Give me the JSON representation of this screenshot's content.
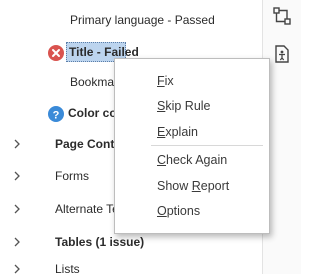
{
  "tree": {
    "primary_language": "Primary language - Passed",
    "title_item": "Title - Failed",
    "bookmarks_partial": "Bookmar",
    "color_contrast_partial": "Color cor",
    "page_content_partial": "Page Conte",
    "forms": "Forms",
    "alternate_text_partial": "Alternate Te",
    "tables": "Tables (1 issue)",
    "lists": "Lists"
  },
  "context_menu": {
    "fix": {
      "key": "F",
      "rest": "ix"
    },
    "skip_rule": {
      "key": "S",
      "rest": "kip Rule"
    },
    "explain": {
      "key": "E",
      "rest": "xplain"
    },
    "check_again": {
      "key": "C",
      "rest": "heck Again"
    },
    "show_report": {
      "pre": "Show ",
      "key": "R",
      "rest": "eport"
    },
    "options": {
      "key": "O",
      "rest": "ptions"
    }
  },
  "colors": {
    "failed": "#d9534f",
    "info": "#3a8ad8",
    "selection": "#bcd4ee"
  },
  "icons": {
    "failed": "failed-x-icon",
    "info": "question-icon",
    "expand": "chevron-right-icon",
    "rail_top": "workflow-icon",
    "rail_second": "accessibility-icon"
  }
}
